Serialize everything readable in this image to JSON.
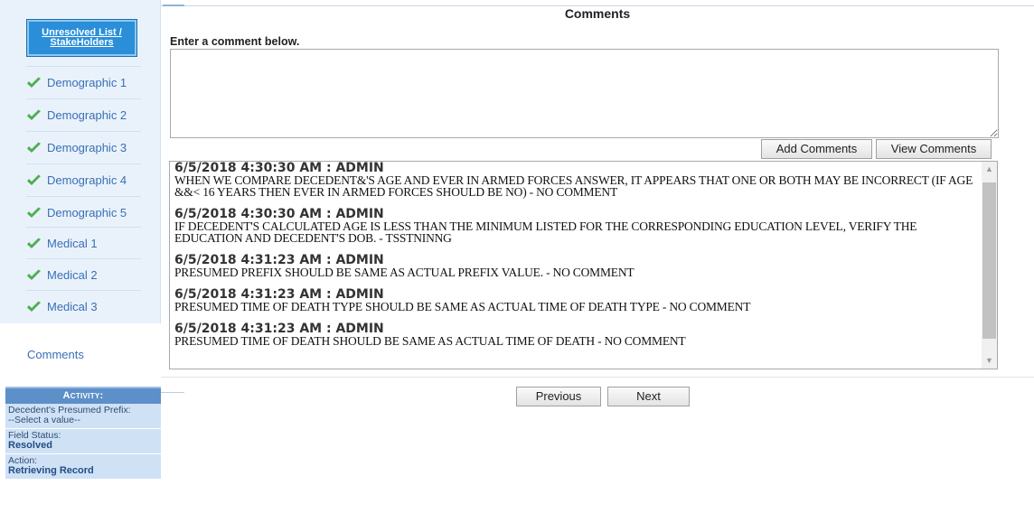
{
  "sidebar": {
    "stakeholders_button": "Unresolved List / StakeHolders",
    "nav_items": [
      {
        "label": "Demographic 1",
        "icon": "check-icon"
      },
      {
        "label": "Demographic 2",
        "icon": "check-icon"
      },
      {
        "label": "Demographic 3",
        "icon": "check-icon"
      },
      {
        "label": "Demographic 4",
        "icon": "check-icon"
      },
      {
        "label": "Demographic 5",
        "icon": "check-icon"
      },
      {
        "label": "Medical 1",
        "icon": "check-icon"
      },
      {
        "label": "Medical 2",
        "icon": "check-icon"
      },
      {
        "label": "Medical 3",
        "icon": "check-icon"
      }
    ],
    "comments_tab": "Comments"
  },
  "activity": {
    "heading": "Activity:",
    "field_label": "Decedent's Presumed Prefix:",
    "field_value": "--Select a value--",
    "status_label": "Field Status:",
    "status_value": "Resolved",
    "action_label": "Action:",
    "action_value": "Retrieving Record"
  },
  "main": {
    "title": "Comments",
    "prompt": "Enter a comment below.",
    "comment_value": "",
    "add_button": "Add Comments",
    "view_button": "View Comments",
    "entries": [
      {
        "header": "6/5/2018 4:30:30 AM : ADMIN",
        "text": "WHEN WE COMPARE DECEDENT&'S AGE AND EVER IN ARMED FORCES ANSWER, IT APPEARS THAT ONE OR BOTH MAY BE INCORRECT (IF AGE &&< 16 YEARS THEN EVER IN ARMED FORCES SHOULD BE NO) - NO COMMENT"
      },
      {
        "header": "6/5/2018 4:30:30 AM : ADMIN",
        "text": "IF DECEDENT'S CALCULATED AGE IS LESS THAN THE MINIMUM LISTED FOR THE CORRESPONDING EDUCATION LEVEL, VERIFY THE EDUCATION AND DECEDENT'S DOB. - TSSTNINNG"
      },
      {
        "header": "6/5/2018 4:31:23 AM : ADMIN",
        "text": "PRESUMED PREFIX SHOULD BE SAME AS ACTUAL PREFIX VALUE. - NO COMMENT"
      },
      {
        "header": "6/5/2018 4:31:23 AM : ADMIN",
        "text": "PRESUMED TIME OF DEATH TYPE SHOULD BE SAME AS ACTUAL TIME OF DEATH TYPE - NO COMMENT"
      },
      {
        "header": "6/5/2018 4:31:23 AM : ADMIN",
        "text": "PRESUMED TIME OF DEATH SHOULD BE SAME AS ACTUAL TIME OF DEATH - NO COMMENT"
      }
    ],
    "previous_button": "Previous",
    "next_button": "Next"
  },
  "colors": {
    "sidebar_bg": "#e9f2fb",
    "accent_blue": "#2a8fd8",
    "nav_text": "#3a6fb5",
    "check_green": "#4caf50",
    "activity_head": "#5d8fc9",
    "activity_bg": "#cfe1f5"
  }
}
